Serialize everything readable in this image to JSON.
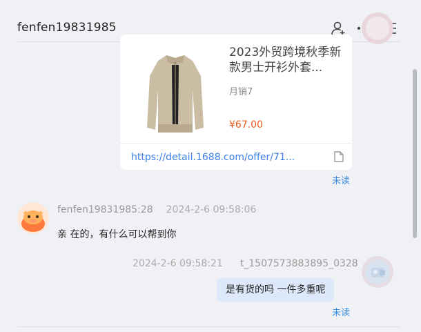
{
  "header": {
    "title": "fenfen19831985",
    "icons": [
      "user-add-icon",
      "more-icon",
      "menu-icon"
    ]
  },
  "product_card": {
    "title": "2023外贸跨境秋季新款男士开衫外套...",
    "sales": "月销7",
    "price": "¥67.00",
    "link": "https://detail.1688.com/offer/71...",
    "unread": "未读"
  },
  "message_left": {
    "sender": "fenfen19831985:28",
    "time": "2024-2-6 09:58:06",
    "text": "亲 在的，有什么可以帮到你"
  },
  "message_right": {
    "time": "2024-2-6 09:58:21",
    "sender": "t_1507573883895_0328",
    "text": "是有货的吗 一件多重呢",
    "unread": "未读"
  },
  "colors": {
    "background": "#f0f1f5",
    "link": "#3a7ee6",
    "price": "#e8581c",
    "bubble": "#dde9fb",
    "unread": "#3a8ee0"
  }
}
